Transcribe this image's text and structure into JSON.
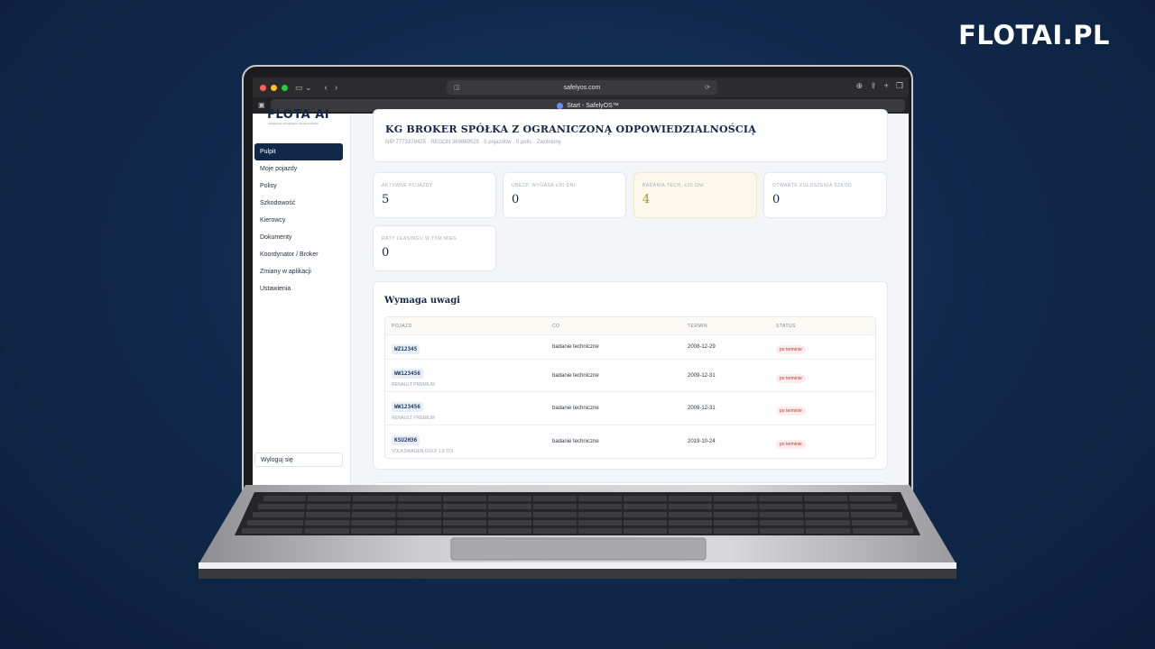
{
  "brand": "FLOTAI.PL",
  "browser": {
    "url": "safelyos.com",
    "tab_title": "Start - SafelyOS™"
  },
  "app": {
    "logo": "FLOTA AI",
    "logo_tagline": "Inteligentne zarządzanie i bezpieczeństwo",
    "nav": [
      {
        "label": "Pulpit",
        "active": true
      },
      {
        "label": "Moje pojazdy",
        "active": false
      },
      {
        "label": "Polisy",
        "active": false
      },
      {
        "label": "Szkodowość",
        "active": false
      },
      {
        "label": "Kierowcy",
        "active": false
      },
      {
        "label": "Dokumenty",
        "active": false
      },
      {
        "label": "Koordynator / Broker",
        "active": false
      },
      {
        "label": "Zmiany w aplikacji",
        "active": false
      },
      {
        "label": "Ustawienia",
        "active": false
      }
    ],
    "logout": "Wyloguj się"
  },
  "company": {
    "name": "KG BROKER SPÓŁKA Z OGRANICZONĄ ODPOWIEDZIALNOŚCIĄ",
    "meta": "NIP 7773378425 · REGON 369869529 · 5 pojazdów · 0 polis · Zwolniony"
  },
  "stats": [
    {
      "label": "AKTYWNE POJAZDY",
      "value": "5"
    },
    {
      "label": "UBEZP. WYGASA ≤30 DNI",
      "value": "0"
    },
    {
      "label": "BADANIA TECH. ≤30 DNI",
      "value": "4"
    },
    {
      "label": "OTWARTE ZGŁOSZENIA SZKÓD",
      "value": "0"
    },
    {
      "label": "RATY LEASINGU W TYM MIES.",
      "value": "0"
    }
  ],
  "alerts": {
    "title": "Wymaga uwagi",
    "columns": [
      "POJAZD",
      "CO",
      "TERMIN",
      "STATUS"
    ],
    "rows": [
      {
        "plate": "WZ12345",
        "model": "",
        "what": "badanie techniczne",
        "date": "2008-12-29",
        "status": "po terminie"
      },
      {
        "plate": "WW123456",
        "model": "RENAULT PREMIUM",
        "what": "badanie techniczne",
        "date": "2009-12-31",
        "status": "po terminie"
      },
      {
        "plate": "WW123456",
        "model": "RENAULT PREMIUM",
        "what": "badanie techniczne",
        "date": "2009-12-31",
        "status": "po terminie"
      },
      {
        "plate": "KSU2H36",
        "model": "VOLKSWAGEN GOLF 1.9 TDI",
        "what": "badanie techniczne",
        "date": "2019-10-24",
        "status": "po terminie"
      }
    ]
  },
  "colors": {
    "navy": "#12284a",
    "accent_warn": "#b08a30",
    "overdue": "#c0392b"
  }
}
